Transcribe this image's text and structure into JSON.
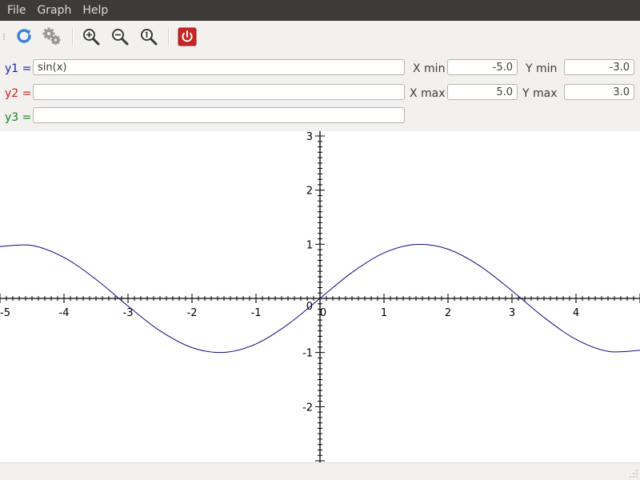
{
  "menu": {
    "items": [
      "File",
      "Graph",
      "Help"
    ]
  },
  "toolbar": {
    "buttons": [
      {
        "icon": "refresh-icon",
        "color": "#3d7fd6"
      },
      {
        "icon": "settings-gears-icon"
      },
      {
        "icon": "zoom-in-icon"
      },
      {
        "icon": "zoom-out-icon"
      },
      {
        "icon": "zoom-reset-icon"
      },
      {
        "icon": "power-quit-icon",
        "color": "#c72424"
      }
    ]
  },
  "functions": [
    {
      "label": "y1 =",
      "value": "sin(x)",
      "color": "#1c1cb0"
    },
    {
      "label": "y2 =",
      "value": "",
      "color": "#d01818"
    },
    {
      "label": "y3 =",
      "value": "",
      "color": "#158015"
    }
  ],
  "range": {
    "xmin_label": "X min",
    "xmin": "-5.0",
    "xmax_label": "X max",
    "xmax": "5.0",
    "ymin_label": "Y min",
    "ymin": "-3.0",
    "ymax_label": "Y max",
    "ymax": "3.0"
  },
  "chart_data": {
    "type": "line",
    "title": "",
    "xlabel": "",
    "ylabel": "",
    "xlim": [
      -5,
      5
    ],
    "ylim": [
      -3,
      3
    ],
    "x_ticks": [
      -5,
      -4,
      -3,
      -2,
      -1,
      0,
      1,
      2,
      3,
      4
    ],
    "y_ticks": [
      -2,
      -1,
      1,
      2,
      3
    ],
    "grid": false,
    "series": [
      {
        "color": "#0a0a80",
        "x": [
          -5,
          -4.5,
          -4,
          -3.5,
          -3,
          -2.5,
          -2,
          -1.5,
          -1,
          -0.5,
          0,
          0.5,
          1,
          1.5,
          2,
          2.5,
          3,
          3.5,
          4,
          4.5,
          5
        ],
        "y": [
          0.959,
          0.978,
          0.757,
          0.351,
          -0.141,
          -0.598,
          -0.909,
          -0.997,
          -0.841,
          -0.479,
          0,
          0.479,
          0.841,
          0.997,
          0.909,
          0.598,
          0.141,
          -0.351,
          -0.757,
          -0.978,
          -0.959
        ]
      }
    ]
  }
}
